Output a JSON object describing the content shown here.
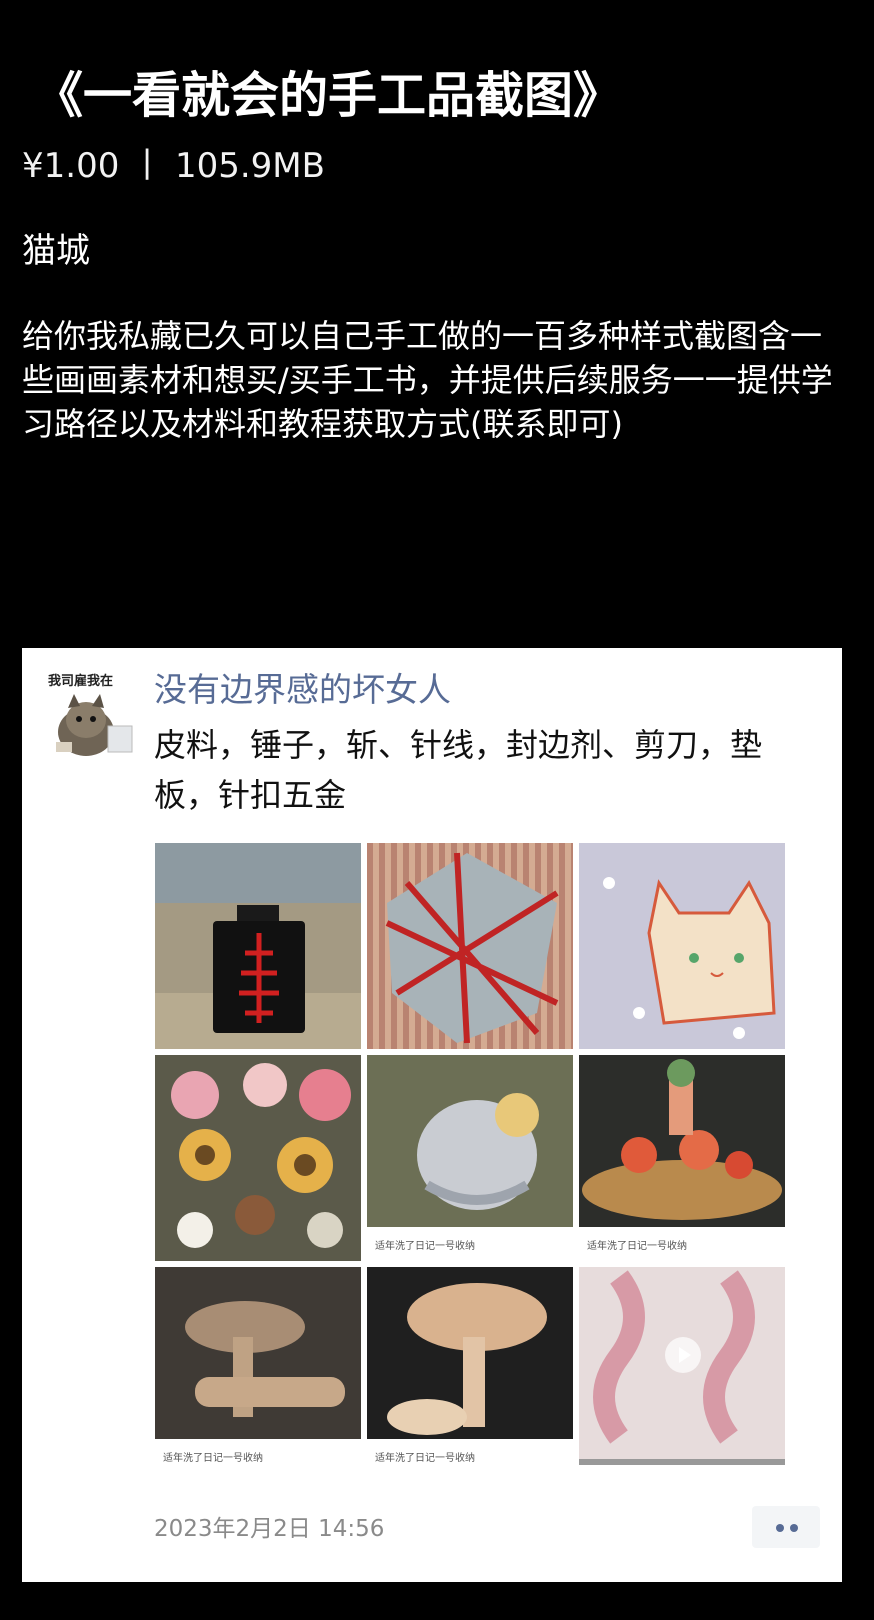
{
  "product": {
    "title": "《一看就会的手工品截图》",
    "price": "¥1.00",
    "separator": "丨",
    "size": "105.9MB",
    "seller": "猫城",
    "description": "给你我私藏已久可以自己手工做的一百多种样式截图含一些画画素材和想买/买手工书，并提供后续服务一一提供学习路径以及材料和教程获取方式(联系即可)"
  },
  "post": {
    "avatar_label": "我司雇我在",
    "poster_name": "没有边界感的坏女人",
    "text": "皮料，锤子，斩、针线，封边剂、剪刀，垫板，针扣五金",
    "timestamp": "2023年2月2日 14:56",
    "images": [
      {
        "name": "perfume-bottle-knot"
      },
      {
        "name": "woven-cushion"
      },
      {
        "name": "cat-face-keychain"
      },
      {
        "name": "crochet-flower-bouquet"
      },
      {
        "name": "doll-figure",
        "caption": "适年洗了日记一号收纳"
      },
      {
        "name": "mushroom-garden-figure",
        "caption": "适年洗了日记一号收纳"
      },
      {
        "name": "clay-figure-hand",
        "caption": "适年洗了日记一号收纳"
      },
      {
        "name": "lace-figure-hand",
        "caption": "适年洗了日记一号收纳"
      },
      {
        "name": "pink-ribbon-video"
      }
    ],
    "colors": {
      "name": "#576b95",
      "time": "#8a8a8a"
    }
  }
}
